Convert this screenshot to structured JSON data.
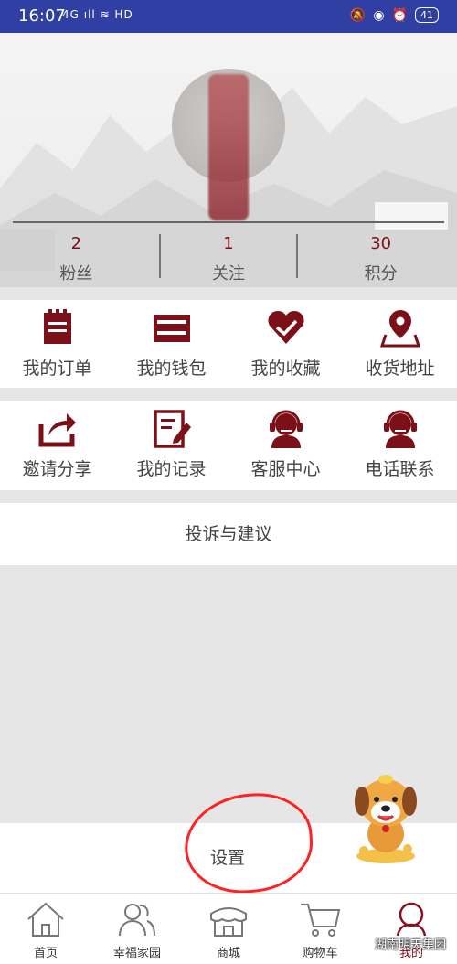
{
  "status_bar": {
    "time": "16:07",
    "left_icons": "4G ıll  ≋ HD",
    "battery": "41"
  },
  "profile": {
    "stats": [
      {
        "value": "2",
        "label": "粉丝"
      },
      {
        "value": "1",
        "label": "关注"
      },
      {
        "value": "30",
        "label": "积分"
      }
    ]
  },
  "grid_row_1": [
    {
      "label": "我的订单",
      "icon": "order-icon"
    },
    {
      "label": "我的钱包",
      "icon": "wallet-icon"
    },
    {
      "label": "我的收藏",
      "icon": "favorite-heart-icon"
    },
    {
      "label": "收货地址",
      "icon": "map-pin-icon"
    }
  ],
  "grid_row_2": [
    {
      "label": "邀请分享",
      "icon": "share-icon"
    },
    {
      "label": "我的记录",
      "icon": "record-edit-icon"
    },
    {
      "label": "客服中心",
      "icon": "customer-service-icon"
    },
    {
      "label": "电话联系",
      "icon": "phone-support-icon"
    }
  ],
  "feedback_label": "投诉与建议",
  "settings_label": "设置",
  "bottom_nav": [
    {
      "label": "首页",
      "icon": "home-icon"
    },
    {
      "label": "幸福家园",
      "icon": "community-icon"
    },
    {
      "label": "商城",
      "icon": "store-icon"
    },
    {
      "label": "购物车",
      "icon": "cart-icon"
    },
    {
      "label": "我的",
      "icon": "profile-icon",
      "active": true
    }
  ],
  "watermark": "湖南明天集团",
  "colors": {
    "brand": "#7c1018",
    "status_bar": "#2f3fa3",
    "annotation_red": "#ff2222"
  }
}
